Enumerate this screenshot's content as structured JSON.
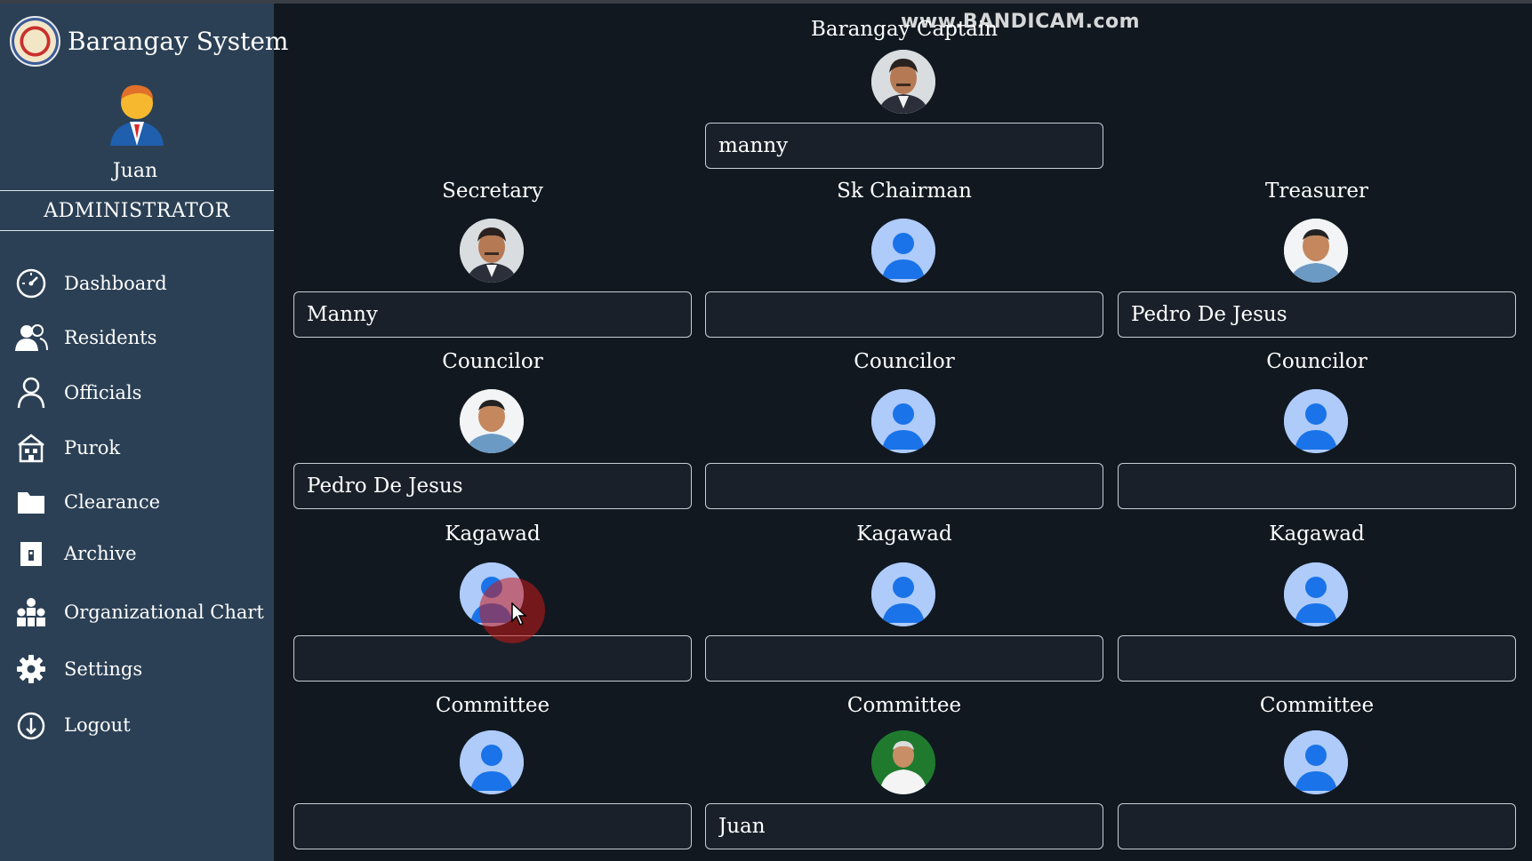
{
  "app": {
    "title": "Barangay System"
  },
  "user": {
    "name": "Juan",
    "role": "ADMINISTRATOR"
  },
  "sidebar": {
    "items": [
      {
        "label": "Dashboard",
        "icon": "dashboard-gauge-icon"
      },
      {
        "label": "Residents",
        "icon": "residents-icon"
      },
      {
        "label": "Officials",
        "icon": "officials-user-icon"
      },
      {
        "label": "Purok",
        "icon": "purok-building-icon"
      },
      {
        "label": "Clearance",
        "icon": "folder-icon"
      },
      {
        "label": "Archive",
        "icon": "archive-icon"
      },
      {
        "label": "Organizational Chart",
        "icon": "org-chart-icon"
      },
      {
        "label": "Settings",
        "icon": "gear-icon"
      },
      {
        "label": "Logout",
        "icon": "power-icon"
      }
    ]
  },
  "watermark": "www.BANDICAM.com",
  "officials": {
    "captain": {
      "title": "Barangay Captain",
      "value": "manny",
      "photo": "captain-photo"
    },
    "secretary": {
      "title": "Secretary",
      "value": "Manny",
      "photo": "official-photo"
    },
    "sk_chairman": {
      "title": "Sk Chairman",
      "value": "",
      "photo": "default-avatar"
    },
    "treasurer": {
      "title": "Treasurer",
      "value": "Pedro De Jesus",
      "photo": "official-photo"
    },
    "councilors": [
      {
        "title": "Councilor",
        "value": "Pedro De Jesus",
        "photo": "official-photo"
      },
      {
        "title": "Councilor",
        "value": "",
        "photo": "default-avatar"
      },
      {
        "title": "Councilor",
        "value": "",
        "photo": "default-avatar"
      }
    ],
    "kagawads": [
      {
        "title": "Kagawad",
        "value": ""
      },
      {
        "title": "Kagawad",
        "value": ""
      },
      {
        "title": "Kagawad",
        "value": ""
      }
    ],
    "committees": [
      {
        "title": "Committee",
        "value": ""
      },
      {
        "title": "Committee",
        "value": "Juan"
      },
      {
        "title": "Committee",
        "value": ""
      }
    ]
  },
  "colors": {
    "sidebar_bg": "#2b4055",
    "main_bg": "#111820",
    "avatar_bg": "#aecbfa",
    "avatar_fg": "#1a73e8",
    "click_indicator": "#c81919"
  }
}
